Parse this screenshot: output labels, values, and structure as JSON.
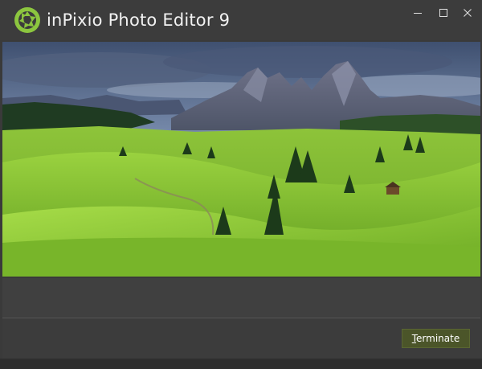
{
  "window": {
    "title": "inPixio Photo Editor 9",
    "controls": {
      "minimize_icon": "minimize-icon",
      "maximize_icon": "maximize-icon",
      "close_icon": "close-icon"
    }
  },
  "logo": {
    "icon": "aperture-logo-icon",
    "color": "#8cc63f"
  },
  "main": {
    "image_description_icon": "landscape-photo"
  },
  "footer": {
    "terminate_prefix": "T",
    "terminate_rest": "erminate",
    "button_color": "#4b5529"
  },
  "colors": {
    "titlebar": "#3c3c3c",
    "background": "#3a3a3a",
    "accent": "#8cc63f"
  }
}
